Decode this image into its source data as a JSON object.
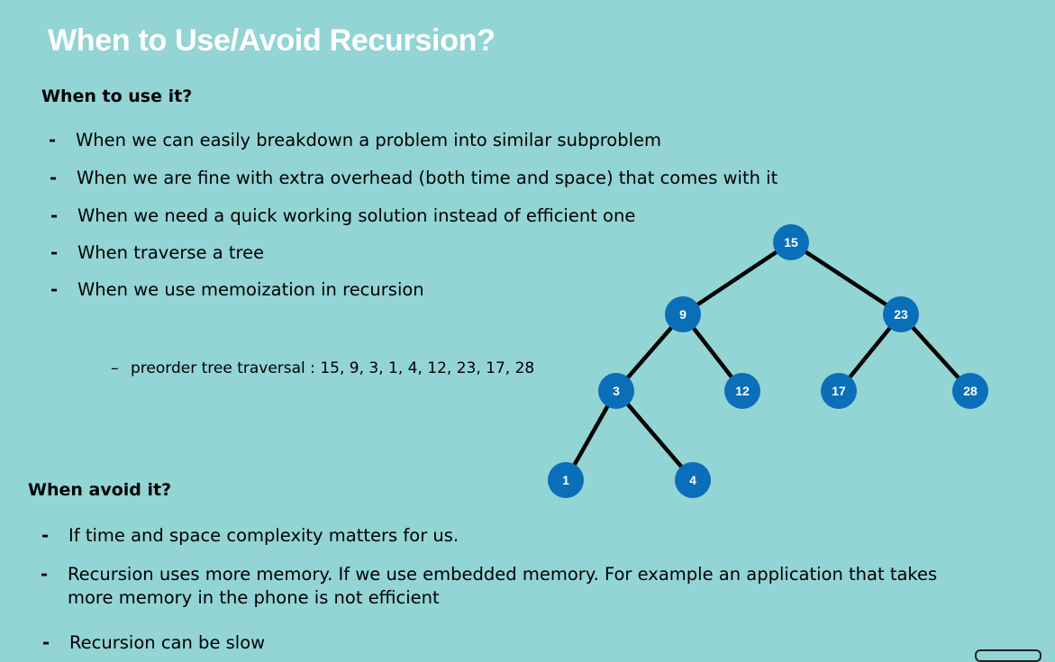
{
  "title": "When to Use/Avoid Recursion?",
  "use_section": {
    "heading": "When to use it?",
    "items": [
      "When we can easily breakdown a problem into similar subproblem",
      "When we are fine with extra overhead (both time and space) that comes with it",
      "When we need a quick working solution instead of efficient one",
      "When traverse a tree",
      "When we use memoization in recursion"
    ],
    "sub_item": "preorder tree traversal : 15, 9, 3, 1, 4, 12, 23, 17, 28"
  },
  "avoid_section": {
    "heading": "When avoid it?",
    "items": [
      "If time and space complexity matters for us.",
      "Recursion uses more memory. If we use embedded memory. For example an application that takes more memory in the phone is not efficient",
      "Recursion can be slow"
    ]
  },
  "bullet_marker": "-",
  "sub_bullet_marker": "–",
  "tree": {
    "node_color": "#0a6fb8",
    "edge_color": "#000000",
    "nodes": [
      {
        "id": "n15",
        "label": "15"
      },
      {
        "id": "n9",
        "label": "9"
      },
      {
        "id": "n23",
        "label": "23"
      },
      {
        "id": "n3",
        "label": "3"
      },
      {
        "id": "n12",
        "label": "12"
      },
      {
        "id": "n17",
        "label": "17"
      },
      {
        "id": "n28",
        "label": "28"
      },
      {
        "id": "n1",
        "label": "1"
      },
      {
        "id": "n4",
        "label": "4"
      }
    ]
  }
}
